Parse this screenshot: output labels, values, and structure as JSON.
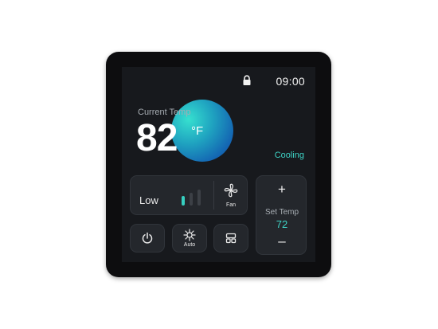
{
  "status_bar": {
    "time": "09:00",
    "lock_icon": "lock-icon"
  },
  "current": {
    "label": "Current Temp",
    "value": "82",
    "unit": "°F"
  },
  "mode_status": "Cooling",
  "fan": {
    "speed_label": "Low",
    "button_label": "Fan",
    "level": 1,
    "levels": 3,
    "icon": "fan-icon"
  },
  "controls": {
    "power_icon": "power-icon",
    "auto_label": "Auto",
    "auto_icon": "snowflake-sun-icon",
    "layout_icon": "layout-icon"
  },
  "setpoint": {
    "plus": "+",
    "label": "Set Temp",
    "value": "72",
    "minus": "–"
  },
  "colors": {
    "accent": "#3ed3c6",
    "orb_start": "#36e0cf",
    "orb_end": "#0f4b9c",
    "screen_bg": "#17191d",
    "tile_bg": "#24272c"
  }
}
